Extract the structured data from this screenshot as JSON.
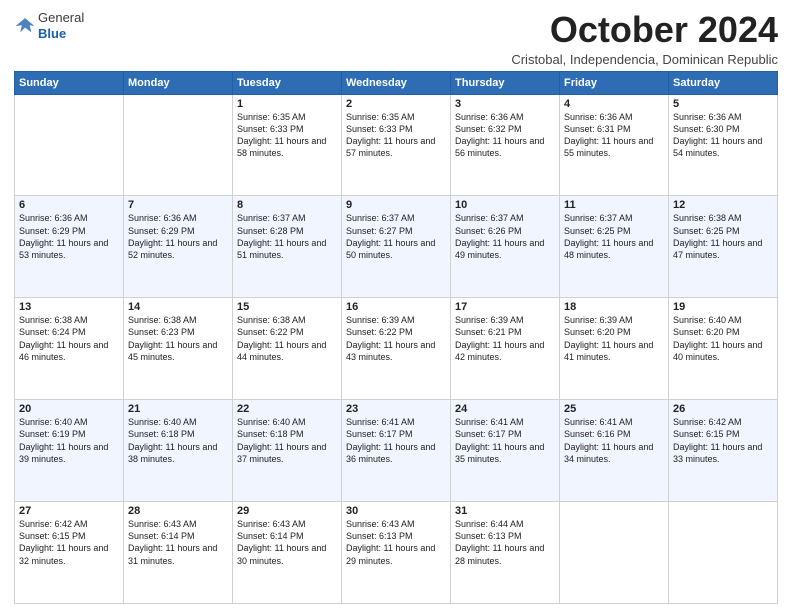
{
  "logo": {
    "general": "General",
    "blue": "Blue"
  },
  "header": {
    "month": "October 2024",
    "location": "Cristobal, Independencia, Dominican Republic"
  },
  "days_of_week": [
    "Sunday",
    "Monday",
    "Tuesday",
    "Wednesday",
    "Thursday",
    "Friday",
    "Saturday"
  ],
  "weeks": [
    [
      {
        "day": "",
        "info": ""
      },
      {
        "day": "",
        "info": ""
      },
      {
        "day": "1",
        "info": "Sunrise: 6:35 AM\nSunset: 6:33 PM\nDaylight: 11 hours and 58 minutes."
      },
      {
        "day": "2",
        "info": "Sunrise: 6:35 AM\nSunset: 6:33 PM\nDaylight: 11 hours and 57 minutes."
      },
      {
        "day": "3",
        "info": "Sunrise: 6:36 AM\nSunset: 6:32 PM\nDaylight: 11 hours and 56 minutes."
      },
      {
        "day": "4",
        "info": "Sunrise: 6:36 AM\nSunset: 6:31 PM\nDaylight: 11 hours and 55 minutes."
      },
      {
        "day": "5",
        "info": "Sunrise: 6:36 AM\nSunset: 6:30 PM\nDaylight: 11 hours and 54 minutes."
      }
    ],
    [
      {
        "day": "6",
        "info": "Sunrise: 6:36 AM\nSunset: 6:29 PM\nDaylight: 11 hours and 53 minutes."
      },
      {
        "day": "7",
        "info": "Sunrise: 6:36 AM\nSunset: 6:29 PM\nDaylight: 11 hours and 52 minutes."
      },
      {
        "day": "8",
        "info": "Sunrise: 6:37 AM\nSunset: 6:28 PM\nDaylight: 11 hours and 51 minutes."
      },
      {
        "day": "9",
        "info": "Sunrise: 6:37 AM\nSunset: 6:27 PM\nDaylight: 11 hours and 50 minutes."
      },
      {
        "day": "10",
        "info": "Sunrise: 6:37 AM\nSunset: 6:26 PM\nDaylight: 11 hours and 49 minutes."
      },
      {
        "day": "11",
        "info": "Sunrise: 6:37 AM\nSunset: 6:25 PM\nDaylight: 11 hours and 48 minutes."
      },
      {
        "day": "12",
        "info": "Sunrise: 6:38 AM\nSunset: 6:25 PM\nDaylight: 11 hours and 47 minutes."
      }
    ],
    [
      {
        "day": "13",
        "info": "Sunrise: 6:38 AM\nSunset: 6:24 PM\nDaylight: 11 hours and 46 minutes."
      },
      {
        "day": "14",
        "info": "Sunrise: 6:38 AM\nSunset: 6:23 PM\nDaylight: 11 hours and 45 minutes."
      },
      {
        "day": "15",
        "info": "Sunrise: 6:38 AM\nSunset: 6:22 PM\nDaylight: 11 hours and 44 minutes."
      },
      {
        "day": "16",
        "info": "Sunrise: 6:39 AM\nSunset: 6:22 PM\nDaylight: 11 hours and 43 minutes."
      },
      {
        "day": "17",
        "info": "Sunrise: 6:39 AM\nSunset: 6:21 PM\nDaylight: 11 hours and 42 minutes."
      },
      {
        "day": "18",
        "info": "Sunrise: 6:39 AM\nSunset: 6:20 PM\nDaylight: 11 hours and 41 minutes."
      },
      {
        "day": "19",
        "info": "Sunrise: 6:40 AM\nSunset: 6:20 PM\nDaylight: 11 hours and 40 minutes."
      }
    ],
    [
      {
        "day": "20",
        "info": "Sunrise: 6:40 AM\nSunset: 6:19 PM\nDaylight: 11 hours and 39 minutes."
      },
      {
        "day": "21",
        "info": "Sunrise: 6:40 AM\nSunset: 6:18 PM\nDaylight: 11 hours and 38 minutes."
      },
      {
        "day": "22",
        "info": "Sunrise: 6:40 AM\nSunset: 6:18 PM\nDaylight: 11 hours and 37 minutes."
      },
      {
        "day": "23",
        "info": "Sunrise: 6:41 AM\nSunset: 6:17 PM\nDaylight: 11 hours and 36 minutes."
      },
      {
        "day": "24",
        "info": "Sunrise: 6:41 AM\nSunset: 6:17 PM\nDaylight: 11 hours and 35 minutes."
      },
      {
        "day": "25",
        "info": "Sunrise: 6:41 AM\nSunset: 6:16 PM\nDaylight: 11 hours and 34 minutes."
      },
      {
        "day": "26",
        "info": "Sunrise: 6:42 AM\nSunset: 6:15 PM\nDaylight: 11 hours and 33 minutes."
      }
    ],
    [
      {
        "day": "27",
        "info": "Sunrise: 6:42 AM\nSunset: 6:15 PM\nDaylight: 11 hours and 32 minutes."
      },
      {
        "day": "28",
        "info": "Sunrise: 6:43 AM\nSunset: 6:14 PM\nDaylight: 11 hours and 31 minutes."
      },
      {
        "day": "29",
        "info": "Sunrise: 6:43 AM\nSunset: 6:14 PM\nDaylight: 11 hours and 30 minutes."
      },
      {
        "day": "30",
        "info": "Sunrise: 6:43 AM\nSunset: 6:13 PM\nDaylight: 11 hours and 29 minutes."
      },
      {
        "day": "31",
        "info": "Sunrise: 6:44 AM\nSunset: 6:13 PM\nDaylight: 11 hours and 28 minutes."
      },
      {
        "day": "",
        "info": ""
      },
      {
        "day": "",
        "info": ""
      }
    ]
  ]
}
